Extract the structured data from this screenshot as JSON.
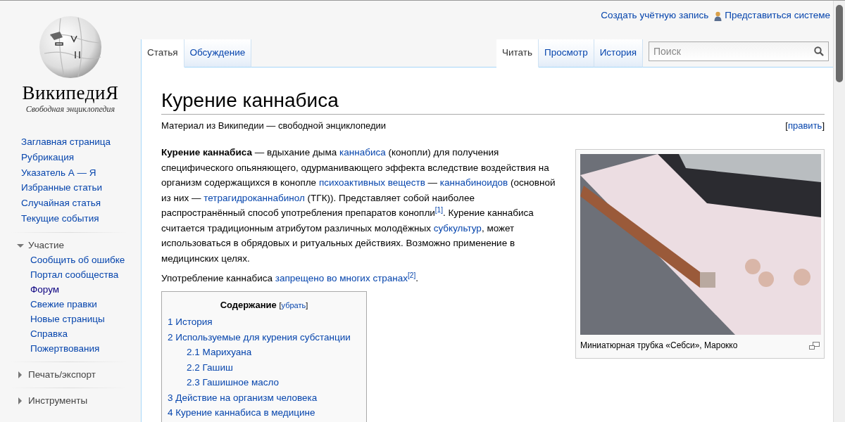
{
  "logo": {
    "wordmark": "ВикипедиЯ",
    "tagline": "Свободная энциклопедия"
  },
  "personal_links": [
    {
      "text": "Создать учётную запись",
      "icon": false
    },
    {
      "text": "Представиться системе",
      "icon": true
    }
  ],
  "left_tabs": [
    {
      "label": "Статья",
      "selected": true
    },
    {
      "label": "Обсуждение",
      "selected": false
    }
  ],
  "right_tabs": [
    {
      "label": "Читать",
      "selected": true
    },
    {
      "label": "Просмотр",
      "selected": false
    },
    {
      "label": "История",
      "selected": false
    }
  ],
  "search": {
    "placeholder": "Поиск"
  },
  "sidebar": {
    "main_links": [
      {
        "text": "Заглавная страница",
        "visited": false
      },
      {
        "text": "Рубрикация",
        "visited": false
      },
      {
        "text": "Указатель А — Я",
        "visited": false
      },
      {
        "text": "Избранные статьи",
        "visited": false
      },
      {
        "text": "Случайная статья",
        "visited": false
      },
      {
        "text": "Текущие события",
        "visited": false
      }
    ],
    "portals": [
      {
        "title": "Участие",
        "expanded": true,
        "items": [
          {
            "text": "Сообщить об ошибке",
            "visited": false
          },
          {
            "text": "Портал сообщества",
            "visited": false
          },
          {
            "text": "Форум",
            "visited": true
          },
          {
            "text": "Свежие правки",
            "visited": false
          },
          {
            "text": "Новые страницы",
            "visited": false
          },
          {
            "text": "Справка",
            "visited": false
          },
          {
            "text": "Пожертвования",
            "visited": false
          }
        ]
      },
      {
        "title": "Печать/экспорт",
        "expanded": false
      },
      {
        "title": "Инструменты",
        "expanded": false
      }
    ]
  },
  "article": {
    "title": "Курение каннабиса",
    "site_sub": "Материал из Википедии — свободной энциклопедии",
    "edit_link": {
      "open": "[",
      "label": "править",
      "close": "]"
    },
    "paragraphs": [
      [
        {
          "kind": "bold",
          "text": "Курение каннабиса"
        },
        {
          "kind": "plain",
          "text": " — вдыхание дыма "
        },
        {
          "kind": "link",
          "text": "каннабиса"
        },
        {
          "kind": "plain",
          "text": " (конопли) для получения специфического опьяняющего, одурманивающего эффекта вследствие воздействия на организм содержащихся в конопле "
        },
        {
          "kind": "link",
          "text": "психоактивных веществ"
        },
        {
          "kind": "plain",
          "text": " — "
        },
        {
          "kind": "link",
          "text": "каннабиноидов"
        },
        {
          "kind": "plain",
          "text": " (основной из них — "
        },
        {
          "kind": "link",
          "text": "тетрагидроканнабинол"
        },
        {
          "kind": "plain",
          "text": " (ТГК)). Представляет собой наиболее распространённый способ употребления препаратов конопли"
        },
        {
          "kind": "ref",
          "text": "[1]"
        },
        {
          "kind": "plain",
          "text": ". Курение каннабиса считается традиционным атрибутом различных молодёжных "
        },
        {
          "kind": "link",
          "text": "субкультур"
        },
        {
          "kind": "plain",
          "text": ", может использоваться в обрядовых и ритуальных действиях. Возможно применение в медицинских целях."
        }
      ],
      [
        {
          "kind": "plain",
          "text": "Употребление каннабиса "
        },
        {
          "kind": "link",
          "text": "запрещено во многих странах"
        },
        {
          "kind": "ref",
          "text": "[2]"
        },
        {
          "kind": "plain",
          "text": "."
        }
      ]
    ],
    "toc": {
      "title": "Содержание",
      "toggle": {
        "open": "[",
        "label": "убрать",
        "close": "]"
      },
      "items": [
        {
          "number": "1",
          "text": "История"
        },
        {
          "number": "2",
          "text": "Используемые для курения субстанции",
          "children": [
            {
              "number": "2.1",
              "text": "Марихуана"
            },
            {
              "number": "2.2",
              "text": "Гашиш"
            },
            {
              "number": "2.3",
              "text": "Гашишное масло"
            }
          ]
        },
        {
          "number": "3",
          "text": "Действие на организм человека"
        },
        {
          "number": "4",
          "text": "Курение каннабиса в медицине"
        }
      ]
    },
    "thumb": {
      "caption": "Миниатюрная трубка «Себси», Марокко"
    }
  }
}
